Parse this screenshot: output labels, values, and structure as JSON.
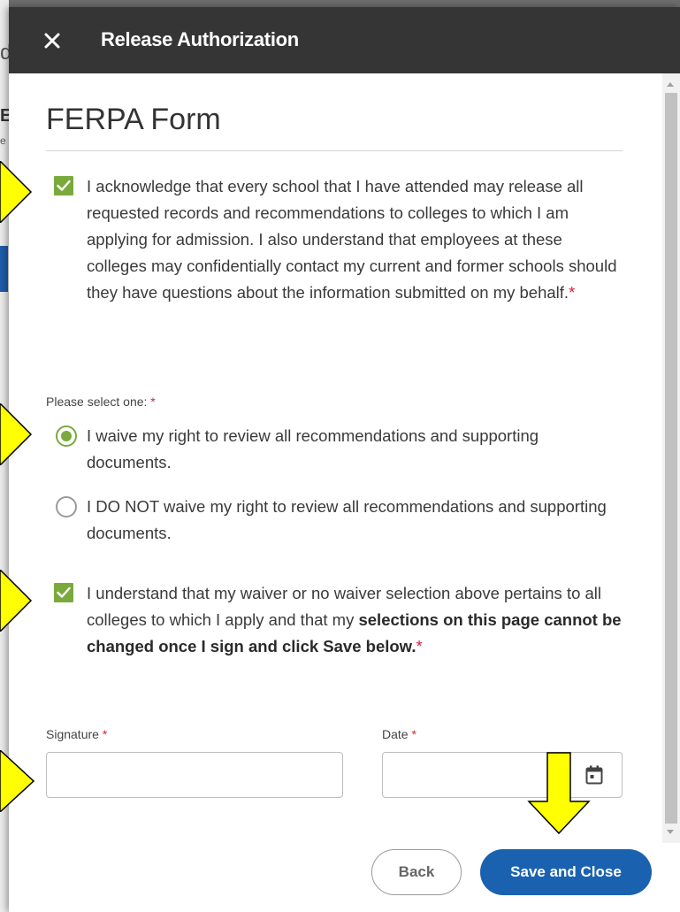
{
  "background_fragments": {
    "frag_d": "d",
    "frag_e": "E",
    "frag_small": "e"
  },
  "modal": {
    "title": "Release Authorization",
    "close_icon": "close-icon"
  },
  "form": {
    "title": "FERPA Form",
    "acknowledge": {
      "checked": true,
      "text": "I acknowledge that every school that I have attended may release all requested records and recommendations to colleges to which I am applying for admission. I also understand that employees at these colleges may confidentially contact my current and former schools should they have questions about the information submitted on my behalf.",
      "required_mark": "*"
    },
    "waiver": {
      "label": "Please select one:",
      "required_mark": "*",
      "options": [
        {
          "label": "I waive my right to review all recommendations and supporting documents.",
          "selected": true
        },
        {
          "label": "I DO NOT waive my right to review all recommendations and supporting documents.",
          "selected": false
        }
      ]
    },
    "understand": {
      "checked": true,
      "text_plain": "I understand that my waiver or no waiver selection above pertains to all colleges to which I apply and that my ",
      "text_bold": "selections on this page cannot be changed once I sign and click Save below.",
      "required_mark": "*"
    },
    "signature": {
      "label": "Signature",
      "required_mark": "*",
      "value": ""
    },
    "date": {
      "label": "Date",
      "required_mark": "*",
      "value": "",
      "icon": "calendar-icon"
    }
  },
  "buttons": {
    "back": "Back",
    "save": "Save and Close"
  },
  "colors": {
    "header_bg": "#353535",
    "accent_green": "#7aaa3c",
    "primary_blue": "#1a62b0",
    "required_red": "#d0243a",
    "annotation_yellow": "#ffff00"
  }
}
